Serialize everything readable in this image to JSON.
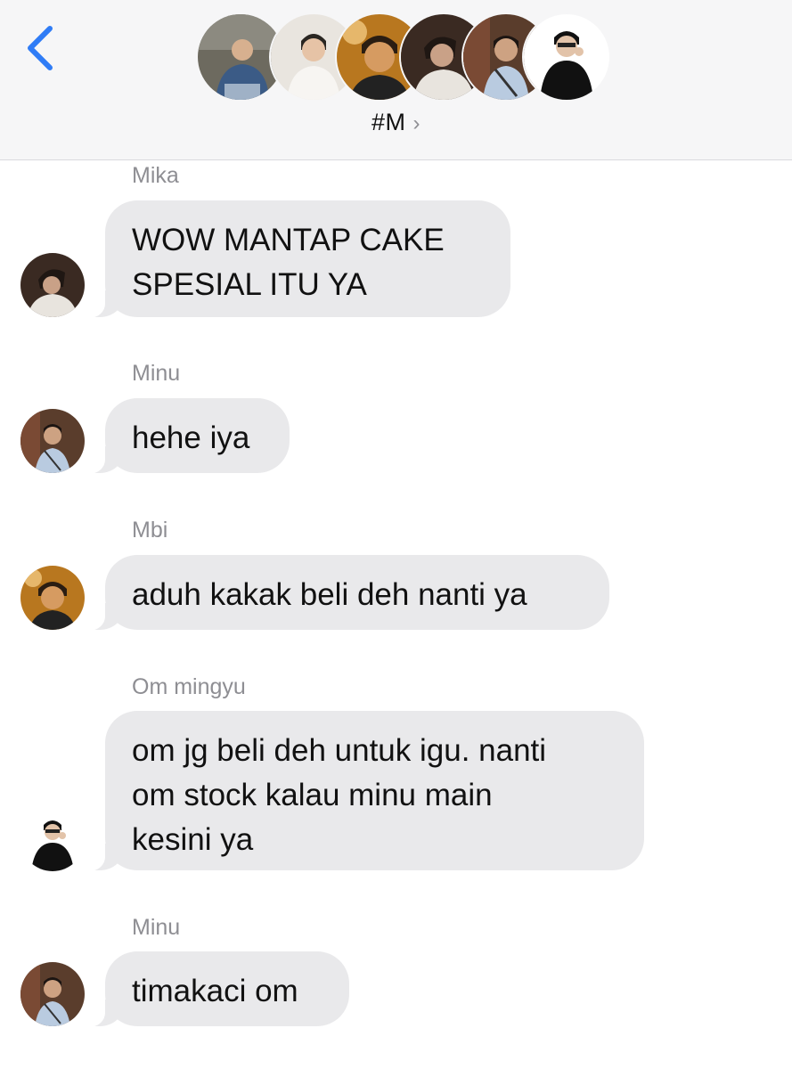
{
  "header": {
    "title": "#M",
    "title_chevron": "›",
    "back_icon": "chevron-left-icon",
    "accent": "#2f7cf6",
    "members": [
      {
        "name": "member-1",
        "bg": "#6d6a5f",
        "skin": "#d7b08f",
        "shirt": "#3b5b86"
      },
      {
        "name": "member-2",
        "bg": "#e9e5df",
        "skin": "#e6c3a6",
        "shirt": "#f2f0ec"
      },
      {
        "name": "member-3",
        "bg": "#b8771f",
        "skin": "#d69b61",
        "shirt": "#222222"
      },
      {
        "name": "member-4",
        "bg": "#3a2a22",
        "skin": "#c9a187",
        "shirt": "#e8e4de"
      },
      {
        "name": "member-5",
        "bg": "#5a3d2c",
        "skin": "#cda282",
        "shirt": "#b9cbe0"
      },
      {
        "name": "member-6",
        "bg": "#ffffff",
        "skin": "#e2c3a9",
        "shirt": "#111111"
      }
    ]
  },
  "messages": [
    {
      "sender": "Mika",
      "text": "WOW MANTAP CAKE SPESIAL ITU YA",
      "lines": [
        "WOW MANTAP CAKE",
        "SPESIAL ITU YA"
      ]
    },
    {
      "sender": "Minu",
      "text": "hehe iya",
      "lines": [
        "hehe iya"
      ]
    },
    {
      "sender": "Mbi",
      "text": "aduh kakak beli deh nanti ya",
      "lines": [
        "aduh kakak beli deh nanti ya"
      ]
    },
    {
      "sender": "Om mingyu",
      "text": "om jg beli deh untuk igu. nanti om stock kalau minu main kesini ya",
      "lines": [
        "om jg beli deh untuk igu. nanti",
        "om stock kalau minu main",
        "kesini ya"
      ]
    },
    {
      "sender": "Minu",
      "text": "timakaci om",
      "lines": [
        "timakaci om"
      ]
    }
  ],
  "colors": {
    "bubble": "#e9e9eb",
    "name_gray": "#8e8e93",
    "header_bg": "#f6f6f7"
  }
}
